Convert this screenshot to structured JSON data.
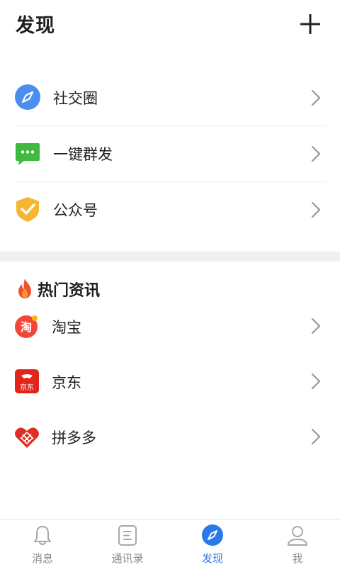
{
  "header": {
    "title": "发现",
    "add_icon": "plus-icon"
  },
  "menu": [
    {
      "label": "社交圈",
      "icon": "compass-icon",
      "color": "#4a8ef0"
    },
    {
      "label": "一键群发",
      "icon": "chat-bubble-icon",
      "color": "#3fb93f"
    },
    {
      "label": "公众号",
      "icon": "shield-check-icon",
      "color": "#f5b731"
    }
  ],
  "hot": {
    "title": "热门资讯",
    "icon": "fire-icon",
    "items": [
      {
        "label": "淘宝",
        "icon": "taobao-icon",
        "badge_text": "淘",
        "color": "#f2463a"
      },
      {
        "label": "京东",
        "icon": "jd-icon",
        "badge_text": "京东",
        "color": "#e1251b"
      },
      {
        "label": "拼多多",
        "icon": "pinduoduo-icon",
        "color": "#e02e24"
      }
    ]
  },
  "tabs": [
    {
      "label": "消息",
      "icon": "bell-icon",
      "active": false
    },
    {
      "label": "通讯录",
      "icon": "contacts-icon",
      "active": false
    },
    {
      "label": "发现",
      "icon": "compass-icon",
      "active": true
    },
    {
      "label": "我",
      "icon": "person-icon",
      "active": false
    }
  ],
  "colors": {
    "accent": "#2b79e8",
    "inactive": "#8a8a8a",
    "separator": "#f0f0f0"
  }
}
